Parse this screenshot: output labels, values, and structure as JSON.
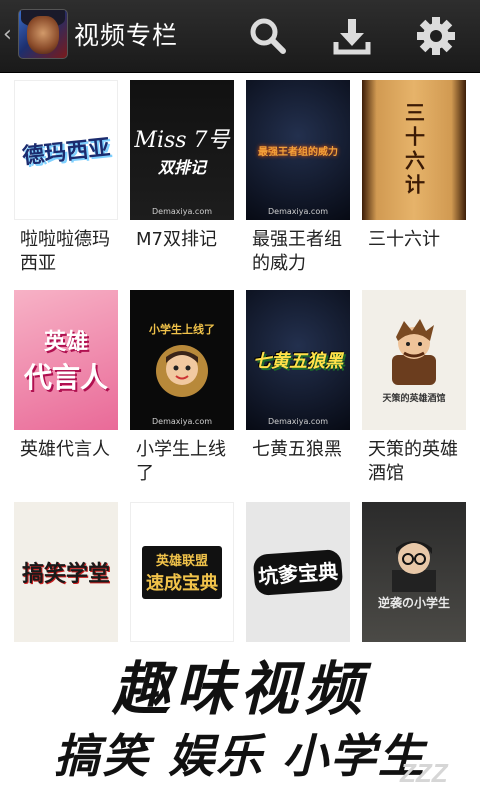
{
  "header": {
    "back_glyph": "‹",
    "title": "视频专栏",
    "icons": [
      "search-icon",
      "download-icon",
      "gear-icon"
    ]
  },
  "videos": [
    {
      "title": "啦啦啦德玛西亚",
      "logo": "德玛西亚"
    },
    {
      "title": "M7双排记",
      "logo_top": "Miss 7号",
      "logo_bottom": "双排记",
      "site": "Demaxiya.com"
    },
    {
      "title": "最强王者组的威力",
      "logo": "最强王者组的威力",
      "site": "Demaxiya.com"
    },
    {
      "title": "三十六计",
      "logo": "三十六计"
    },
    {
      "title": "英雄代言人",
      "logo_top": "英雄",
      "logo_bottom": "代言人"
    },
    {
      "title": "小学生上线了",
      "logo": "小学生上线了",
      "site": "Demaxiya.com"
    },
    {
      "title": "七黄五狼黑",
      "logo": "七黄五狼黑",
      "site": "Demaxiya.com"
    },
    {
      "title": "天策的英雄酒馆",
      "logo": "天策的英雄酒馆"
    },
    {
      "title": "",
      "logo": "搞笑学堂"
    },
    {
      "title": "",
      "logo_top": "英雄联盟",
      "logo_bottom": "速成宝典"
    },
    {
      "title": "",
      "logo": "坑爹宝典"
    },
    {
      "title": "",
      "logo": "逆袭の小学生"
    }
  ],
  "banner": {
    "line1": "趣味视频",
    "line2": "搞笑 娱乐 小学生"
  },
  "colors": {
    "topbar": "#1f1f1f",
    "accent_red": "#d62020",
    "gold": "#f0c24a"
  }
}
